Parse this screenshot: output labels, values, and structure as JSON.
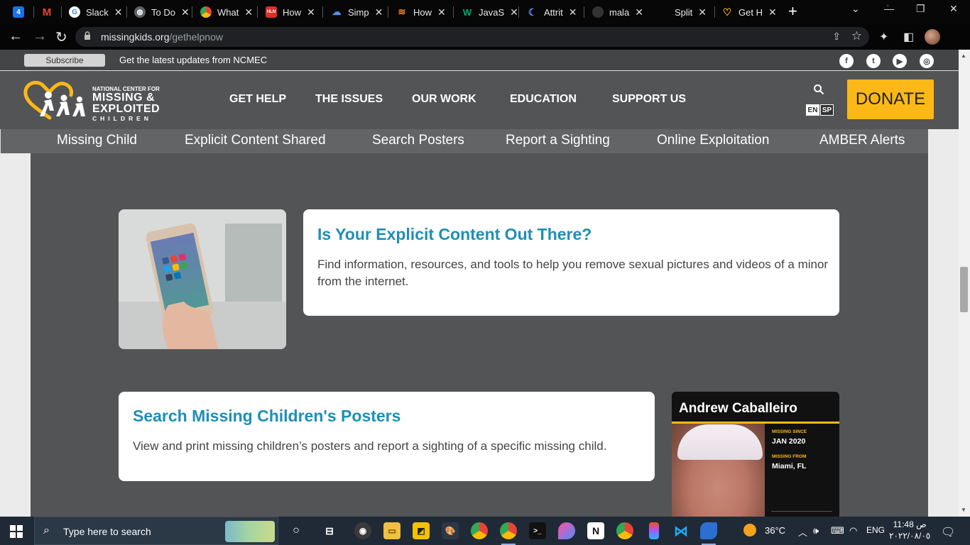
{
  "browser": {
    "tabs": [
      {
        "label": "",
        "icon": "cal-icon",
        "color": "#1a73e8"
      },
      {
        "label": "",
        "icon": "gmail-icon",
        "color": "#ea4335"
      },
      {
        "label": "Slack",
        "icon": "google-icon",
        "color": "#4285f4"
      },
      {
        "label": "To Do",
        "icon": "globe-icon",
        "color": "#666666"
      },
      {
        "label": "What",
        "icon": "chrome-icon",
        "color": "#34a853"
      },
      {
        "label": "How",
        "icon": "huhu-icon",
        "color": "#d93025"
      },
      {
        "label": "Simp",
        "icon": "cloud-icon",
        "color": "#5b8def"
      },
      {
        "label": "How",
        "icon": "stackoverflow-icon",
        "color": "#f48024"
      },
      {
        "label": "JavaS",
        "icon": "w3-icon",
        "color": "#04aa6d"
      },
      {
        "label": "Attrit",
        "icon": "moon-icon",
        "color": "#5b8def"
      },
      {
        "label": "mala",
        "icon": "github-icon",
        "color": "#333333"
      },
      {
        "label": "Split",
        "icon": "blank-icon",
        "color": "#070707"
      },
      {
        "label": "Get H",
        "icon": "ncmec-icon",
        "color": "#fcb816"
      }
    ],
    "new_tab": "+",
    "url_host": "missingkids.org",
    "url_path": "/gethelpnow"
  },
  "site": {
    "subscribe": "Subscribe",
    "strip_text": "Get the latest updates from NCMEC",
    "social": [
      "f",
      "t",
      "▶",
      "◎"
    ],
    "logo": {
      "line1": "NATIONAL CENTER FOR",
      "line2": "MISSING &",
      "line3": "EXPLOITED",
      "line4": "CHILDREN"
    },
    "nav": [
      "GET HELP",
      "THE ISSUES",
      "OUR WORK",
      "EDUCATION",
      "SUPPORT US"
    ],
    "lang_en": "EN",
    "lang_sp": "SP",
    "donate": "DONATE",
    "subnav": [
      "Missing Child",
      "Explicit Content Shared",
      "Search Posters",
      "Report a Sighting",
      "Online Exploitation",
      "AMBER Alerts"
    ],
    "card1": {
      "title": "Is Your Explicit Content Out There?",
      "body": "Find information, resources, and tools to help you remove sexual pictures and videos of a minor from the internet."
    },
    "card2": {
      "title": "Search Missing Children's Posters",
      "body": "View and print missing children’s posters and report a sighting of a specific missing child."
    },
    "poster": {
      "name": "Andrew Caballeiro",
      "since_label": "MISSING SINCE",
      "since_value": "JAN 2020",
      "from_label": "MISSING FROM",
      "from_value": "Miami, FL"
    }
  },
  "taskbar": {
    "search_placeholder": "Type here to search",
    "temperature": "36°C",
    "lang": "ENG",
    "time": "11:48 ص",
    "date": "٢٠٢٢/٠٨/٠٥"
  },
  "colors": {
    "accent_blue": "#1f8fb5",
    "donate_yellow": "#fcb816",
    "header_gray": "#535456"
  }
}
